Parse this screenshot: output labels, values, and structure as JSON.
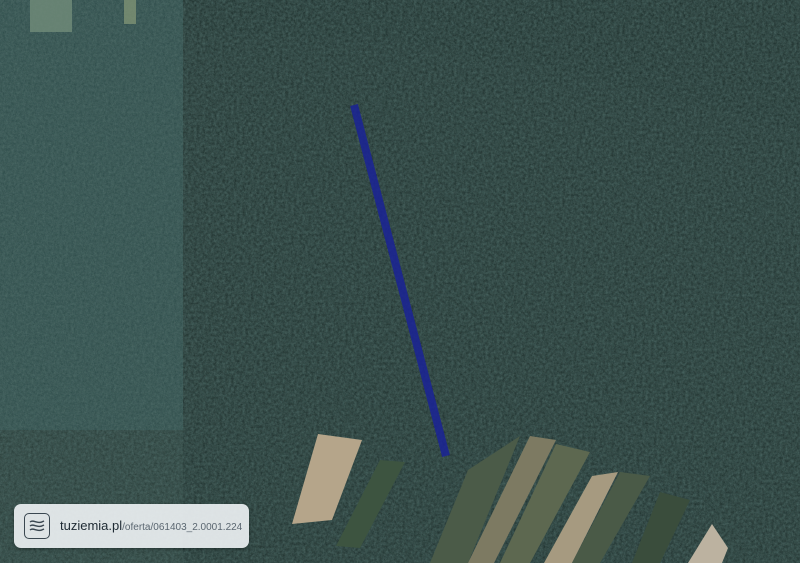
{
  "map": {
    "type": "satellite-imagery",
    "parcel_line_color": "#1a2396"
  },
  "badge": {
    "icon": "map-contour-icon",
    "site": "tuziemia.pl",
    "path": "/oferta/061403_2.0001.224"
  }
}
